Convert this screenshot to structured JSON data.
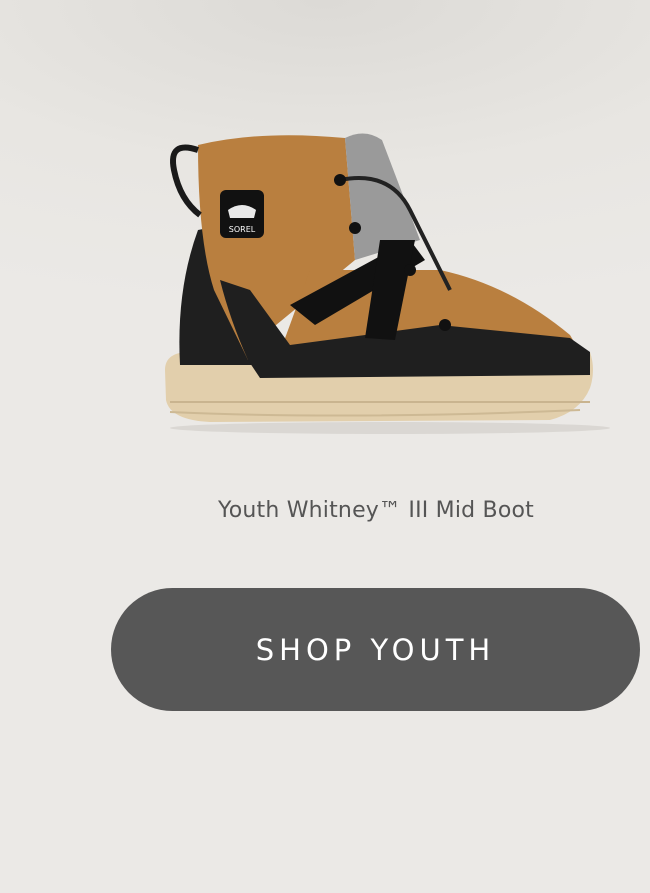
{
  "product": {
    "name": "Youth Whitney™ III Mid Boot",
    "image_icon": "boot-image",
    "badge_text": "SOREL",
    "colors": {
      "upper": "#b97f3f",
      "trim": "#1f1f1f",
      "sole": "#e2cfac"
    }
  },
  "cta": {
    "label": "SHOP YOUTH",
    "background": "#575757",
    "text_color": "#ffffff"
  }
}
